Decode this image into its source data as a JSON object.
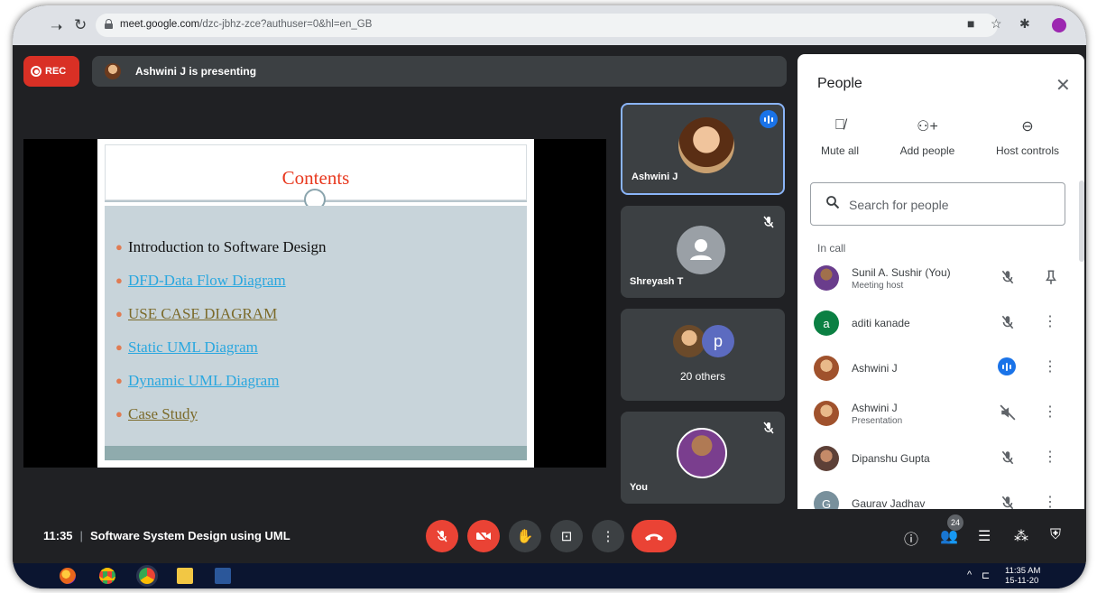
{
  "browser": {
    "url_host": "meet.google.com",
    "url_path": "/dzc-jbhz-zce?authuser=0&hl=en_GB"
  },
  "meet": {
    "rec_label": "REC",
    "presenting_text": "Ashwini J is presenting"
  },
  "slide": {
    "title": "Contents",
    "bullets": [
      {
        "text": "Introduction to Software Design",
        "style": "plain"
      },
      {
        "text": "DFD-Data Flow Diagram",
        "style": "link"
      },
      {
        "text": "USE CASE DIAGRAM",
        "style": "olive"
      },
      {
        "text": "Static UML Diagram",
        "style": "link"
      },
      {
        "text": "Dynamic UML Diagram",
        "style": "link"
      },
      {
        "text": "Case Study",
        "style": "olive"
      }
    ]
  },
  "tiles": {
    "t1_name": "Ashwini J",
    "t2_name": "Shreyash T",
    "t3_others": "20 others",
    "t3_letter": "p",
    "t4_name": "You"
  },
  "people": {
    "title": "People",
    "actions": [
      "Mute all",
      "Add people",
      "Host controls"
    ],
    "search_placeholder": "Search for people",
    "section_label": "In call",
    "list": [
      {
        "name": "Sunil A. Sushir (You)",
        "sub": "Meeting host",
        "avatar_letter": "",
        "avatar_color": "#6a3d8c"
      },
      {
        "name": "aditi kanade",
        "sub": "",
        "avatar_letter": "a",
        "avatar_color": "#0b8043"
      },
      {
        "name": "Ashwini J",
        "sub": "",
        "avatar_letter": "",
        "avatar_color": "#a0522d"
      },
      {
        "name": "Ashwini J",
        "sub": "Presentation",
        "avatar_letter": "",
        "avatar_color": "#a0522d"
      },
      {
        "name": "Dipanshu Gupta",
        "sub": "",
        "avatar_letter": "",
        "avatar_color": "#5d4037"
      },
      {
        "name": "Gaurav Jadhav",
        "sub": "",
        "avatar_letter": "G",
        "avatar_color": "#78909c"
      }
    ]
  },
  "bottom": {
    "time": "11:35",
    "meeting_name": "Software System Design using UML",
    "people_count": "24"
  },
  "taskbar": {
    "time": "11:35 AM",
    "date": "15-11-20"
  },
  "colors": {
    "rec": "#d93025",
    "accent_blue": "#1a73e8",
    "hangup": "#ea4335",
    "slide_title": "#e8391f"
  }
}
